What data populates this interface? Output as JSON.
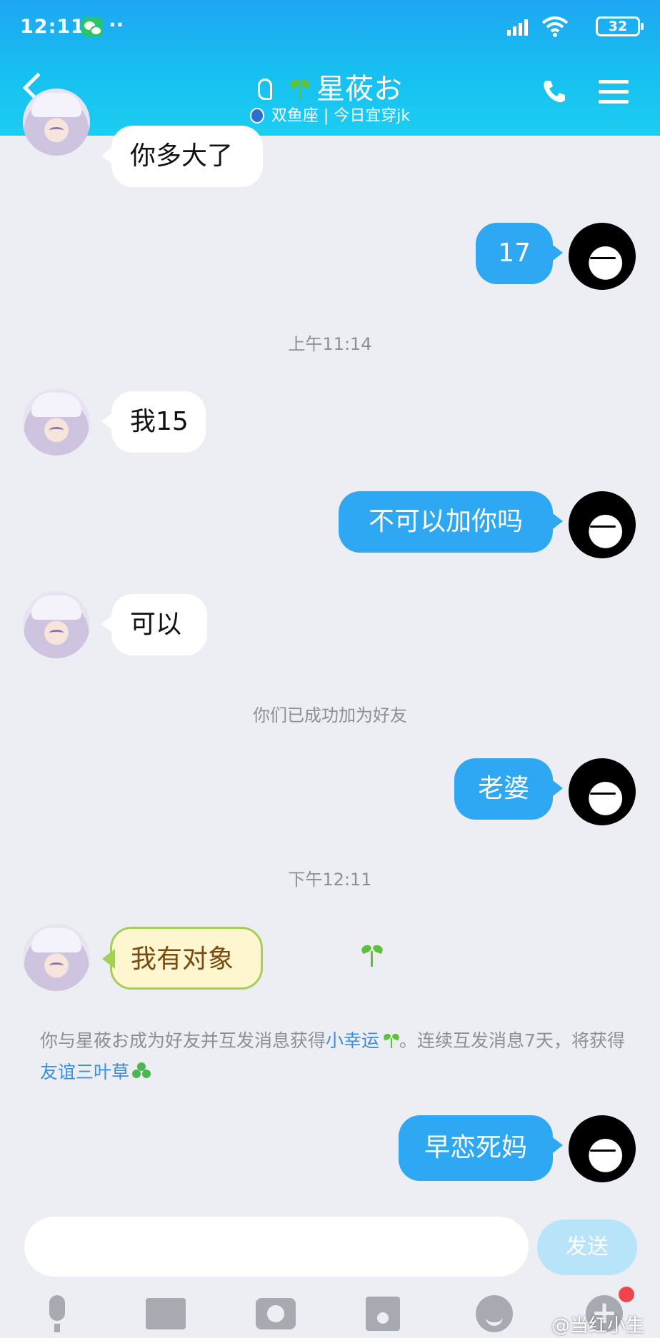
{
  "status_bar": {
    "time": "12:11",
    "dots": "··",
    "battery": "32"
  },
  "header": {
    "name": "星莜お",
    "subtitle": "双鱼座 | 今日宜穿jk"
  },
  "messages": [
    {
      "side": "left",
      "text": "你多大了"
    },
    {
      "side": "right",
      "text": "17"
    },
    {
      "side": "time",
      "text": "上午11:14"
    },
    {
      "side": "left",
      "text": "我15"
    },
    {
      "side": "right",
      "text": "不可以加你吗"
    },
    {
      "side": "left",
      "text": "可以"
    },
    {
      "side": "system",
      "text": "你们已成功加为好友"
    },
    {
      "side": "right",
      "text": "老婆"
    },
    {
      "side": "time",
      "text": "下午12:11"
    },
    {
      "side": "left",
      "text": "我有对象"
    },
    {
      "side": "right",
      "text": "早恋死妈"
    }
  ],
  "friendship_notice": {
    "part1": "你与星莜お成为好友并互发消息获得",
    "highlight1": "小幸运",
    "part2": "。连续互发消息7天，将获得",
    "highlight2": "友谊三叶草"
  },
  "input": {
    "send_label": "发送"
  },
  "watermark": "@当红小生",
  "colors": {
    "header": "#1fb4f2",
    "bubble_right": "#2ea8f3",
    "bubble_left": "#ffffff",
    "background": "#eceef4"
  },
  "icons": [
    "back-icon",
    "ear-icon",
    "sprout-icon",
    "phone-icon",
    "menu-icon",
    "mic-icon",
    "image-icon",
    "camera-icon",
    "red-packet-icon",
    "emoji-icon",
    "plus-icon"
  ]
}
